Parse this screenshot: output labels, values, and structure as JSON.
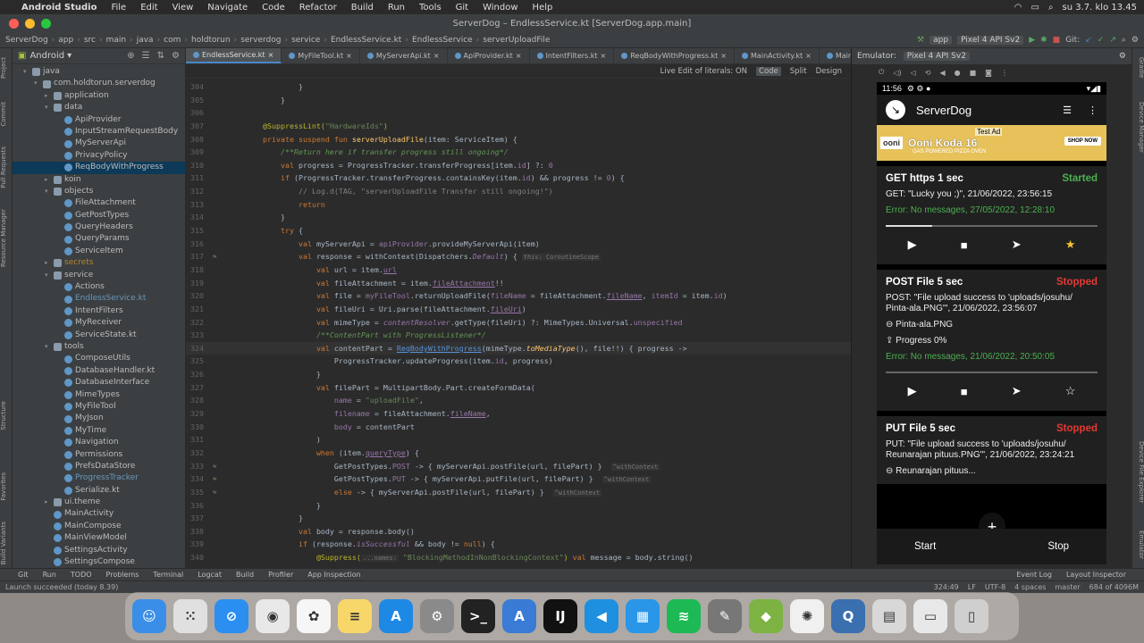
{
  "mac_menu": {
    "app": "Android Studio",
    "items": [
      "File",
      "Edit",
      "View",
      "Navigate",
      "Code",
      "Refactor",
      "Build",
      "Run",
      "Tools",
      "Git",
      "Window",
      "Help"
    ],
    "clock": "su 3.7. klo 13.45"
  },
  "window_title": "ServerDog – EndlessService.kt [ServerDog.app.main]",
  "breadcrumb": [
    "ServerDog",
    "app",
    "src",
    "main",
    "java",
    "com",
    "holdtorun",
    "serverdog",
    "service",
    "EndlessService.kt",
    "EndlessService",
    "serverUploadFile"
  ],
  "toolbar": {
    "config": "app",
    "device": "Pixel 4 API Sv2",
    "git": "Git:"
  },
  "left_tabs": [
    "Project",
    "Commit",
    "Pull Requests",
    "Resource Manager",
    "Structure",
    "Favorites",
    "Build Variants"
  ],
  "right_tabs": [
    "Gradle",
    "Device Manager",
    "Device File Explorer",
    "Emulator"
  ],
  "project": {
    "view": "Android",
    "tree": [
      {
        "d": 1,
        "t": "java",
        "k": "folder",
        "o": 1
      },
      {
        "d": 2,
        "t": "com.holdtorun.serverdog",
        "k": "folder",
        "o": 1
      },
      {
        "d": 3,
        "t": "application",
        "k": "folder",
        "o": 0
      },
      {
        "d": 3,
        "t": "data",
        "k": "folder",
        "o": 1
      },
      {
        "d": 4,
        "t": "ApiProvider",
        "k": "kt"
      },
      {
        "d": 4,
        "t": "InputStreamRequestBody",
        "k": "kt"
      },
      {
        "d": 4,
        "t": "MyServerApi",
        "k": "kt"
      },
      {
        "d": 4,
        "t": "PrivacyPolicy",
        "k": "kt"
      },
      {
        "d": 4,
        "t": "ReqBodyWithProgress",
        "k": "kt",
        "sel": 1
      },
      {
        "d": 3,
        "t": "koin",
        "k": "folder",
        "o": 0
      },
      {
        "d": 3,
        "t": "objects",
        "k": "folder",
        "o": 1
      },
      {
        "d": 4,
        "t": "FileAttachment",
        "k": "kt"
      },
      {
        "d": 4,
        "t": "GetPostTypes",
        "k": "kt"
      },
      {
        "d": 4,
        "t": "QueryHeaders",
        "k": "kt"
      },
      {
        "d": 4,
        "t": "QueryParams",
        "k": "kt"
      },
      {
        "d": 4,
        "t": "ServiceItem",
        "k": "kt"
      },
      {
        "d": 3,
        "t": "secrets",
        "k": "folder",
        "o": 0,
        "c": "#b3872e"
      },
      {
        "d": 3,
        "t": "service",
        "k": "folder",
        "o": 1
      },
      {
        "d": 4,
        "t": "Actions",
        "k": "kt"
      },
      {
        "d": 4,
        "t": "EndlessService.kt",
        "k": "kt",
        "c": "#6897bb"
      },
      {
        "d": 4,
        "t": "IntentFilters",
        "k": "kt"
      },
      {
        "d": 4,
        "t": "MyReceiver",
        "k": "kt"
      },
      {
        "d": 4,
        "t": "ServiceState.kt",
        "k": "kt"
      },
      {
        "d": 3,
        "t": "tools",
        "k": "folder",
        "o": 1
      },
      {
        "d": 4,
        "t": "ComposeUtils",
        "k": "kt"
      },
      {
        "d": 4,
        "t": "DatabaseHandler.kt",
        "k": "kt"
      },
      {
        "d": 4,
        "t": "DatabaseInterface",
        "k": "kt"
      },
      {
        "d": 4,
        "t": "MimeTypes",
        "k": "kt"
      },
      {
        "d": 4,
        "t": "MyFileTool",
        "k": "kt"
      },
      {
        "d": 4,
        "t": "MyJson",
        "k": "kt"
      },
      {
        "d": 4,
        "t": "MyTime",
        "k": "kt"
      },
      {
        "d": 4,
        "t": "Navigation",
        "k": "kt"
      },
      {
        "d": 4,
        "t": "Permissions",
        "k": "kt"
      },
      {
        "d": 4,
        "t": "PrefsDataStore",
        "k": "kt"
      },
      {
        "d": 4,
        "t": "ProgressTracker",
        "k": "kt",
        "c": "#6897bb"
      },
      {
        "d": 4,
        "t": "Serialize.kt",
        "k": "kt"
      },
      {
        "d": 3,
        "t": "ui.theme",
        "k": "folder",
        "o": 0
      },
      {
        "d": 3,
        "t": "MainActivity",
        "k": "kt"
      },
      {
        "d": 3,
        "t": "MainCompose",
        "k": "kt"
      },
      {
        "d": 3,
        "t": "MainViewModel",
        "k": "kt"
      },
      {
        "d": 3,
        "t": "SettingsActivity",
        "k": "kt"
      },
      {
        "d": 3,
        "t": "SettingsCompose",
        "k": "kt"
      }
    ]
  },
  "tabs": [
    {
      "t": "EndlessService.kt",
      "a": 1
    },
    {
      "t": "MyFileTool.kt"
    },
    {
      "t": "MyServerApi.kt"
    },
    {
      "t": "ApiProvider.kt"
    },
    {
      "t": "IntentFilters.kt"
    },
    {
      "t": "ReqBodyWithProgress.kt"
    },
    {
      "t": "MainActivity.kt"
    },
    {
      "t": "MainViewModel.kt"
    }
  ],
  "editor_bar": [
    "Live Edit of literals: ON",
    "Code",
    "Split",
    "Design"
  ],
  "code": [
    {
      "n": "304",
      "h": "            <span>}</span>"
    },
    {
      "n": "305",
      "h": "        }"
    },
    {
      "n": "306",
      "h": ""
    },
    {
      "n": "307",
      "h": "    <span class='a'>@SuppressLint(</span><span class='s'>\"HardwareIds\"</span><span class='a'>)</span>"
    },
    {
      "n": "308",
      "h": "    <span class='k'>private suspend fun </span><span class='f'>serverUploadFile</span>(item: ServiceItem) {"
    },
    {
      "n": "309",
      "h": "        <span class='c'>/**Return here if transfer progress still ongoing*/</span>"
    },
    {
      "n": "310",
      "h": "        <span class='k'>val </span>progress = ProgressTracker.transferProgress[item.<span class='p'>id</span>] ?: <span class='p'>0</span>"
    },
    {
      "n": "311",
      "h": "        <span class='k'>if </span>(ProgressTracker.transferProgress.containsKey(item.<span class='p'>id</span>) && progress != <span class='p'>0</span>) {"
    },
    {
      "n": "312",
      "h": "            <span style='color:#808080'>// Log.d(TAG, \"serverUploadFile Transfer still ongoing!\")</span>"
    },
    {
      "n": "313",
      "h": "            <span class='k'>return</span>"
    },
    {
      "n": "314",
      "h": "        }"
    },
    {
      "n": "315",
      "h": "        <span class='k'>try </span>{"
    },
    {
      "n": "316",
      "h": "            <span class='k'>val </span>myServerApi = <span class='p'>apiProvider</span>.provideMyServerApi(item)"
    },
    {
      "n": "317",
      "g": "⇆",
      "h": "            <span class='k'>val </span>response = withContext(Dispatchers.<span class='p it'>Default</span>) { <span class='hint'>this: CoroutineScope</span>"
    },
    {
      "n": "318",
      "h": "                <span class='k'>val </span>url = item.<span class='p ul'>url</span>"
    },
    {
      "n": "319",
      "h": "                <span class='k'>val </span>fileAttachment = item.<span class='p ul'>fileAttachment</span>!!"
    },
    {
      "n": "320",
      "h": "                <span class='k'>val </span>file = <span class='p'>myFileTool</span>.returnUploadFile(<span class='p'>fileName</span> = fileAttachment.<span class='p ul'>fileName</span>, <span class='p'>itemId</span> = item.<span class='p'>id</span>)"
    },
    {
      "n": "321",
      "h": "                <span class='k'>val </span>fileUri = Uri.parse(fileAttachment.<span class='p ul'>fileUri</span>)"
    },
    {
      "n": "322",
      "h": "                <span class='k'>val </span>mimeType = <span class='p it'>contentResolver</span>.getType(fileUri) ?: MimeTypes.Universal.<span class='p'>unspecified</span>"
    },
    {
      "n": "323",
      "h": "                <span class='c'>/**ContentPart with ProgressListener*/</span>"
    },
    {
      "n": "324",
      "cur": 1,
      "h": "                <span class='k'>val </span>contentPart = <span class='lnk'>ReqBodyWithProgress</span>(mimeType.<span class='f it'>toMediaType</span>(), file!!) { progress ->"
    },
    {
      "n": "325",
      "h": "                    ProgressTracker.updateProgress(item.<span class='p'>id</span>, progress)"
    },
    {
      "n": "326",
      "h": "                }"
    },
    {
      "n": "327",
      "h": "                <span class='k'>val </span>filePart = MultipartBody.Part.createFormData("
    },
    {
      "n": "328",
      "h": "                    <span class='p'>name</span> = <span class='s'>\"uploadFile\"</span>,"
    },
    {
      "n": "329",
      "h": "                    <span class='p'>filename</span> = fileAttachment.<span class='p ul'>fileName</span>,"
    },
    {
      "n": "330",
      "h": "                    <span class='p'>body</span> = contentPart"
    },
    {
      "n": "331",
      "h": "                )"
    },
    {
      "n": "332",
      "h": "                <span class='k'>when </span>(item.<span class='p ul'>queryType</span>) {"
    },
    {
      "n": "333",
      "g": "⇆",
      "h": "                    GetPostTypes.<span class='p'>POST</span> -> { myServerApi.postFile(url, filePart) }  <span class='hint'>^withContext</span>"
    },
    {
      "n": "334",
      "g": "⇆",
      "h": "                    GetPostTypes.<span class='p'>PUT</span> -> { myServerApi.putFile(url, filePart) }  <span class='hint'>^withContext</span>"
    },
    {
      "n": "335",
      "g": "⇆",
      "h": "                    <span class='k'>else </span>-> { myServerApi.postFile(url, filePart) }  <span class='hint'>^withContext</span>"
    },
    {
      "n": "336",
      "h": "                }"
    },
    {
      "n": "337",
      "h": "            }"
    },
    {
      "n": "338",
      "h": "            <span class='k'>val </span>body = response.body()"
    },
    {
      "n": "339",
      "h": "            <span class='k'>if </span>(response.<span class='p it'>isSuccessful</span> && body != <span class='k'>null</span>) {"
    },
    {
      "n": "340",
      "h": "                <span class='a'>@Suppress(</span><span class='hint'>...names:</span> <span class='s'>\"BlockingMethodInNonBlockingContext\"</span><span class='a'>)</span> <span class='k'>val </span>message = body.string()"
    }
  ],
  "emulator": {
    "label": "Emulator:",
    "device": "Pixel 4 API Sv2",
    "time": "11:56",
    "app_title": "ServerDog",
    "ad": {
      "logo": "ooni",
      "title": "Ooni Koda 16",
      "sub": "GAS POWERED PIZZA OVEN",
      "test": "Test Ad",
      "shop": "SHOP NOW"
    },
    "cards": [
      {
        "title": "GET https 1 sec",
        "status": "Started",
        "status_color": "#4caf50",
        "lines": [
          "GET: \"Lucky you ;)\", 21/06/2022, 23:56:15"
        ],
        "error": "Error: No messages, 27/05/2022, 12:28:10",
        "progress": 0.22,
        "starred": true
      },
      {
        "title": "POST File 5 sec",
        "status": "Stopped",
        "status_color": "#e53935",
        "lines": [
          "POST: \"File upload success to 'uploads/josuhu/ Pinta-ala.PNG'\", 21/06/2022, 23:56:07"
        ],
        "file": "Pinta-ala.PNG",
        "progress_text": "Progress 0%",
        "error": "Error: No messages, 21/06/2022, 20:50:05",
        "progress": 0.0,
        "starred": false
      },
      {
        "title": "PUT File 5 sec",
        "status": "Stopped",
        "status_color": "#e53935",
        "lines": [
          "PUT: \"File upload success to 'uploads/josuhu/ Reunarajan pituus.PNG'\", 21/06/2022, 23:24:21"
        ],
        "file": "Reunarajan pituus..."
      }
    ],
    "start": "Start",
    "stop": "Stop"
  },
  "bottom_tools": [
    "Git",
    "Run",
    "TODO",
    "Problems",
    "Terminal",
    "Logcat",
    "Build",
    "Profiler",
    "App Inspection"
  ],
  "bottom_right": [
    "Event Log",
    "Layout Inspector"
  ],
  "status": {
    "msg": "Launch succeeded (today 8.39)",
    "pos": "324:49",
    "lf": "LF",
    "enc": "UTF-8",
    "indent": "4 spaces",
    "branch": "master",
    "mem": "684 of 4096M"
  },
  "dock": [
    {
      "n": "Finder",
      "c": "#3b8ee8",
      "g": "☺"
    },
    {
      "n": "Launchpad",
      "c": "#e0e0e0",
      "g": "⁙"
    },
    {
      "n": "Safari",
      "c": "#2a8ff0",
      "g": "⊘"
    },
    {
      "n": "Chrome",
      "c": "#e8e8e8",
      "g": "◉"
    },
    {
      "n": "Photos",
      "c": "#f6f6f6",
      "g": "✿"
    },
    {
      "n": "Notes",
      "c": "#f7d76a",
      "g": "≡"
    },
    {
      "n": "App Store",
      "c": "#1e88e5",
      "g": "A"
    },
    {
      "n": "System Preferences",
      "c": "#8a8a8a",
      "g": "⚙"
    },
    {
      "n": "Terminal",
      "c": "#222",
      "g": ">_"
    },
    {
      "n": "Android Studio",
      "c": "#3a7bd5",
      "g": "A"
    },
    {
      "n": "IntelliJ IDEA",
      "c": "#111",
      "g": "IJ"
    },
    {
      "n": "VS Code",
      "c": "#1f8fe0",
      "g": "◀"
    },
    {
      "n": "Docker",
      "c": "#2a96e8",
      "g": "▦"
    },
    {
      "n": "Spotify",
      "c": "#1db954",
      "g": "≋"
    },
    {
      "n": "GIMP",
      "c": "#777",
      "g": "✎"
    },
    {
      "n": "Android",
      "c": "#7cb342",
      "g": "◆"
    },
    {
      "n": "SteelSeries",
      "c": "#f0f0f0",
      "g": "✺"
    },
    {
      "n": "QuickTime",
      "c": "#3a6fb0",
      "g": "Q"
    },
    {
      "n": "Preview",
      "c": "#d8d8d8",
      "g": "▤"
    },
    {
      "n": "Invoice",
      "c": "#e8e8e8",
      "g": "▭"
    },
    {
      "n": "Trash",
      "c": "#cfcfcf",
      "g": "▯"
    }
  ]
}
